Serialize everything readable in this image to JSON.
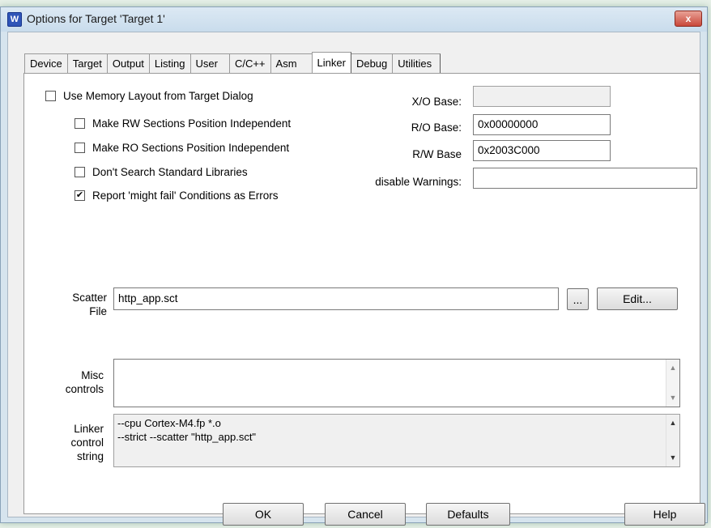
{
  "window": {
    "title": "Options for Target 'Target 1'",
    "close_symbol": "x",
    "app_icon_glyph": "W"
  },
  "tabs": [
    "Device",
    "Target",
    "Output",
    "Listing",
    "User",
    "C/C++",
    "Asm",
    "Linker",
    "Debug",
    "Utilities"
  ],
  "active_tab": "Linker",
  "checkboxes": {
    "use_memory_layout": {
      "label": "Use Memory Layout from Target Dialog",
      "checked": false
    },
    "rw_position_independent": {
      "label": "Make RW Sections Position Independent",
      "checked": false
    },
    "ro_position_independent": {
      "label": "Make RO Sections Position Independent",
      "checked": false
    },
    "dont_search_std_libs": {
      "label": "Don't Search Standard Libraries",
      "checked": false
    },
    "report_might_fail": {
      "label": "Report 'might fail' Conditions as Errors",
      "checked": true
    }
  },
  "fields": {
    "xo_base": {
      "label": "X/O Base:",
      "value": ""
    },
    "ro_base": {
      "label": "R/O Base:",
      "value": "0x00000000"
    },
    "rw_base": {
      "label": "R/W Base",
      "value": "0x2003C000"
    },
    "disable_warnings": {
      "label": "disable Warnings:",
      "value": ""
    }
  },
  "scatter": {
    "label_line1": "Scatter",
    "label_line2": "File",
    "value": "http_app.sct",
    "browse_label": "...",
    "edit_label": "Edit..."
  },
  "misc": {
    "label_line1": "Misc",
    "label_line2": "controls",
    "value": ""
  },
  "linker_control": {
    "label_line1": "Linker",
    "label_line2": "control",
    "label_line3": "string",
    "line1": "--cpu Cortex-M4.fp *.o",
    "line2": "--strict --scatter \"http_app.sct\""
  },
  "buttons": {
    "ok": "OK",
    "cancel": "Cancel",
    "defaults": "Defaults",
    "help": "Help"
  },
  "scroll_glyphs": {
    "up": "▲",
    "down": "▼"
  },
  "colors": {
    "close_button": "#c9483a",
    "app_icon": "#2f55b8",
    "dialog_background": "#f0f0f0"
  }
}
